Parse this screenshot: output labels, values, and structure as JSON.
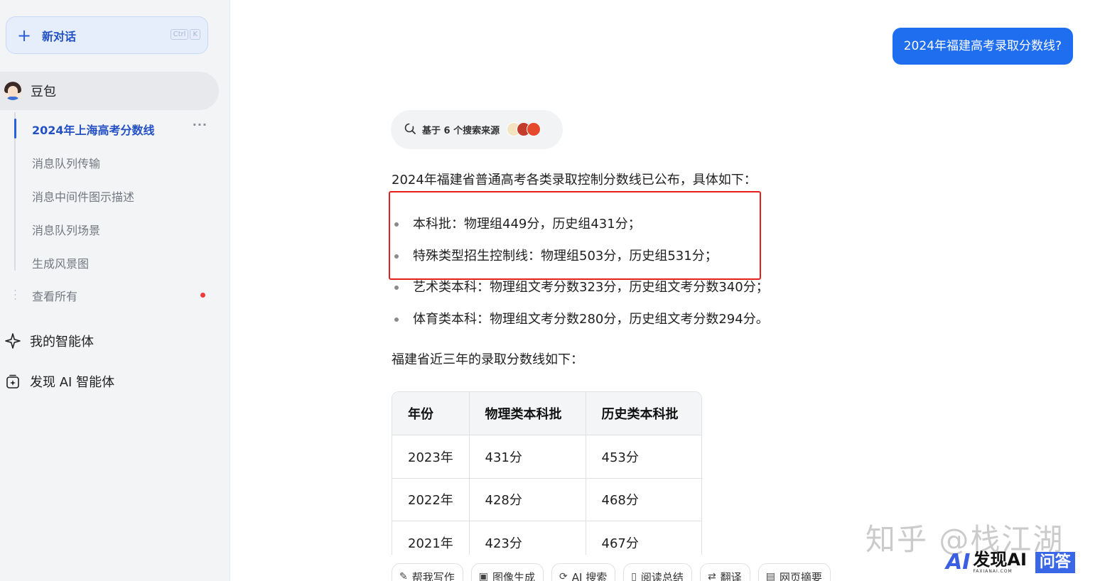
{
  "sidebar": {
    "new_chat_label": "新对话",
    "shortcut": [
      "Ctrl",
      "K"
    ],
    "bot_name": "豆包",
    "history": [
      {
        "label": "2024年上海高考分数线",
        "active": true
      },
      {
        "label": "消息队列传输"
      },
      {
        "label": "消息中间件图示描述"
      },
      {
        "label": "消息队列场景"
      },
      {
        "label": "生成风景图"
      }
    ],
    "see_all_label": "查看所有",
    "my_agents_label": "我的智能体",
    "discover_label": "发现 AI 智能体"
  },
  "chat": {
    "user_message": "2024年福建高考录取分数线?",
    "sources_label": "基于 6 个搜索来源",
    "source_icon_colors": [
      "#f3e3c0",
      "#c23b2b",
      "#e54a2c"
    ],
    "intro": "2024年福建省普通高考各类录取控制分数线已公布，具体如下：",
    "bullets": [
      "本科批：物理组449分，历史组431分；",
      "特殊类型招生控制线：物理组503分，历史组531分；",
      "艺术类本科：物理组文考分数323分，历史组文考分数340分；",
      "体育类本科：物理组文考分数280分，历史组文考分数294分。"
    ],
    "recent_intro": "福建省近三年的录取分数线如下：",
    "table": {
      "headers": [
        "年份",
        "物理类本科批",
        "历史类本科批"
      ],
      "rows": [
        [
          "2023年",
          "431分",
          "453分"
        ],
        [
          "2022年",
          "428分",
          "468分"
        ],
        [
          "2021年",
          "423分",
          "467分"
        ]
      ]
    }
  },
  "toolbar": [
    {
      "icon": "pen-icon",
      "label": "帮我写作"
    },
    {
      "icon": "image-icon",
      "label": "图像生成"
    },
    {
      "icon": "search-icon",
      "label": "AI 搜索"
    },
    {
      "icon": "read-icon",
      "label": "阅读总结"
    },
    {
      "icon": "translate-icon",
      "label": "翻译"
    },
    {
      "icon": "webpage-icon",
      "label": "网页摘要"
    }
  ],
  "watermark": {
    "text": "知乎 @栈江湖",
    "logo_big": "发现AI",
    "logo_small": "FAXIANAI.COM",
    "logo_badge": "问答"
  },
  "colors": {
    "accent": "#1f6ef0",
    "highlight_border": "#e5201b",
    "sidebar_bg": "#f3f4f6"
  }
}
